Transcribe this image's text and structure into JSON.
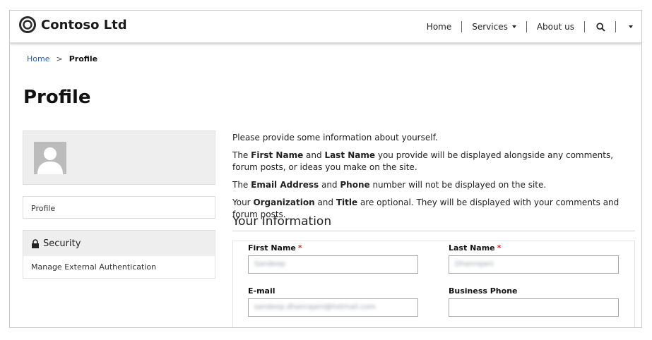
{
  "header": {
    "brand": "Contoso Ltd",
    "nav": {
      "home": "Home",
      "services": "Services",
      "about": "About us"
    }
  },
  "breadcrumb": {
    "home": "Home",
    "separator": ">",
    "current": "Profile"
  },
  "page_title": "Profile",
  "sidebar": {
    "profile_link": "Profile",
    "security_heading": "Security",
    "manage_external_auth": "Manage External Authentication"
  },
  "intro": {
    "line1": "Please provide some information about yourself.",
    "line2_a": "The ",
    "line2_b": "First Name",
    "line2_c": " and ",
    "line2_d": "Last Name",
    "line2_e": " you provide will be displayed alongside any comments, forum posts, or ideas you make on the site.",
    "line3_a": "The ",
    "line3_b": "Email Address",
    "line3_c": " and ",
    "line3_d": "Phone",
    "line3_e": " number will not be displayed on the site.",
    "line4_a": "Your ",
    "line4_b": "Organization",
    "line4_c": " and ",
    "line4_d": "Title",
    "line4_e": " are optional. They will be displayed with your comments and forum posts."
  },
  "your_information": {
    "title": "Your Information",
    "required_marker": "*",
    "first_name": {
      "label": "First Name",
      "value": "Sandeep"
    },
    "last_name": {
      "label": "Last Name",
      "value": "Dhanrajani"
    },
    "email": {
      "label": "E-mail",
      "value": "sandeep.dhanrajani@hotmail.com"
    },
    "business_phone": {
      "label": "Business Phone",
      "value": ""
    }
  },
  "icons": {
    "logo": "contoso-ring-logo",
    "search": "search-icon",
    "lock": "lock-icon",
    "avatar": "user-avatar-placeholder"
  },
  "colors": {
    "link": "#2f5fa7",
    "required": "#c0392b",
    "panel": "#eeeeee"
  }
}
